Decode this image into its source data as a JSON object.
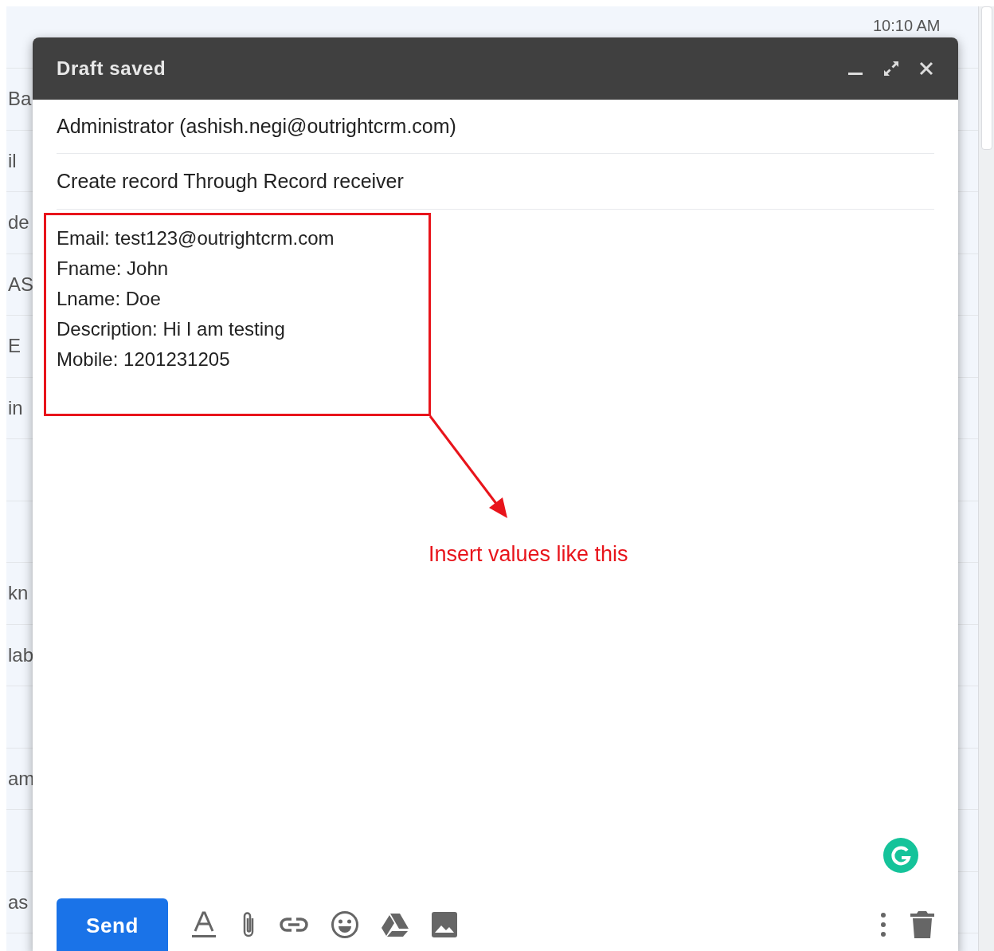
{
  "background_list": {
    "time": "10:10 AM",
    "rows": [
      "Ba",
      "il",
      "de",
      "AS",
      "E",
      "in",
      "",
      "",
      "kn",
      "lab",
      "",
      "am",
      "",
      "as"
    ]
  },
  "compose": {
    "title": "Draft saved",
    "recipient": "Administrator (ashish.negi@outrightcrm.com)",
    "subject": "Create record Through Record receiver",
    "body_lines": [
      "Email: test123@outrightcrm.com",
      "Fname: John",
      "Lname: Doe",
      "Description: Hi I am testing",
      "Mobile: 1201231205"
    ],
    "annotation": "Insert values like this",
    "send_button": "Send"
  }
}
